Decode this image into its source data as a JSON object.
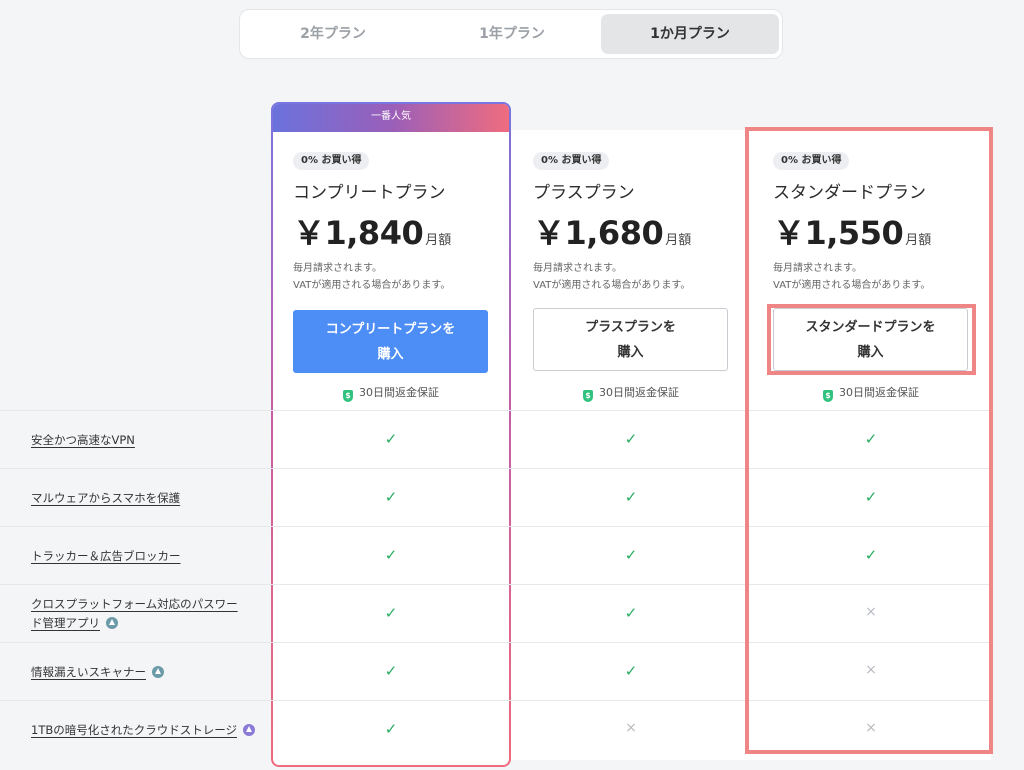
{
  "tabs": [
    {
      "label": "2年プラン",
      "selected": false
    },
    {
      "label": "1年プラン",
      "selected": false
    },
    {
      "label": "1か月プラン",
      "selected": true
    }
  ],
  "plans": [
    {
      "ribbon": "一番人気",
      "badge": "0% お買い得",
      "name": "コンプリートプラン",
      "price": "￥1,840",
      "period": "月額",
      "note1": "毎月請求されます。",
      "note2": "VATが適用される場合があります。",
      "button_line1": "コンプリートプランを",
      "button_line2": "購入",
      "guarantee": "30日間返金保証"
    },
    {
      "badge": "0% お買い得",
      "name": "プラスプラン",
      "price": "￥1,680",
      "period": "月額",
      "note1": "毎月請求されます。",
      "note2": "VATが適用される場合があります。",
      "button_line1": "プラスプランを",
      "button_line2": "購入",
      "guarantee": "30日間返金保証"
    },
    {
      "badge": "0% お買い得",
      "name": "スタンダードプラン",
      "price": "￥1,550",
      "period": "月額",
      "note1": "毎月請求されます。",
      "note2": "VATが適用される場合があります。",
      "button_line1": "スタンダードプランを",
      "button_line2": "購入",
      "guarantee": "30日間返金保証"
    }
  ],
  "features": [
    {
      "label": "安全かつ高速なVPN",
      "complete": true,
      "plus": true,
      "standard": true
    },
    {
      "label": "マルウェアからスマホを保護",
      "complete": true,
      "plus": true,
      "standard": true
    },
    {
      "label": "トラッカー＆広告ブロッカー",
      "complete": true,
      "plus": true,
      "standard": true
    },
    {
      "label": "クロスプラットフォーム対応のパスワード管理アプリ",
      "complete": true,
      "plus": true,
      "standard": false
    },
    {
      "label": "情報漏えいスキャナー",
      "complete": true,
      "plus": true,
      "standard": false
    },
    {
      "label": "1TBの暗号化されたクラウドストレージ",
      "complete": true,
      "plus": false,
      "standard": false
    }
  ],
  "icons": {
    "check": "✓",
    "cross": "×"
  },
  "colors": {
    "primary_button": "#4d8df6",
    "check": "#27ae60",
    "highlight": "#ef8585"
  }
}
